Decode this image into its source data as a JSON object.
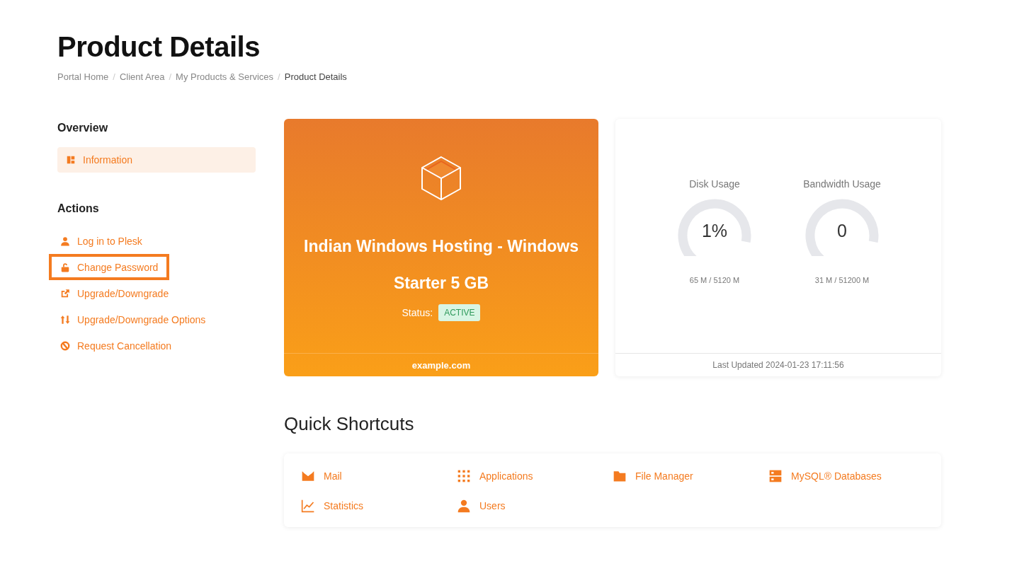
{
  "page_title": "Product Details",
  "breadcrumb_separator": "/",
  "breadcrumb": [
    {
      "label": "Portal Home",
      "current": false
    },
    {
      "label": "Client Area",
      "current": false
    },
    {
      "label": "My Products & Services",
      "current": false
    },
    {
      "label": "Product Details",
      "current": true
    }
  ],
  "sidebar": {
    "overview_heading": "Overview",
    "overview_items": [
      {
        "label": "Information",
        "selected": true
      }
    ],
    "actions_heading": "Actions",
    "actions": [
      {
        "label": "Log in to Plesk",
        "highlighted": false
      },
      {
        "label": "Change Password",
        "highlighted": true
      },
      {
        "label": "Upgrade/Downgrade",
        "highlighted": false
      },
      {
        "label": "Upgrade/Downgrade Options",
        "highlighted": false
      },
      {
        "label": "Request Cancellation",
        "highlighted": false
      }
    ]
  },
  "product_card": {
    "title": "Indian Windows Hosting - Windows Starter 5 GB",
    "status_label": "Status:",
    "status": "ACTIVE",
    "domain": "example.com"
  },
  "usage_card": {
    "gauges": [
      {
        "title": "Disk Usage",
        "reading": "1%",
        "detail": "65 M / 5120 M"
      },
      {
        "title": "Bandwidth Usage",
        "reading": "0",
        "detail": "31 M / 51200 M"
      }
    ],
    "footer": "Last Updated 2024-01-23 17:11:56"
  },
  "shortcuts": {
    "heading": "Quick Shortcuts",
    "items": [
      {
        "label": "Mail"
      },
      {
        "label": "Applications"
      },
      {
        "label": "File Manager"
      },
      {
        "label": "MySQL® Databases"
      },
      {
        "label": "Statistics"
      },
      {
        "label": "Users"
      }
    ]
  }
}
